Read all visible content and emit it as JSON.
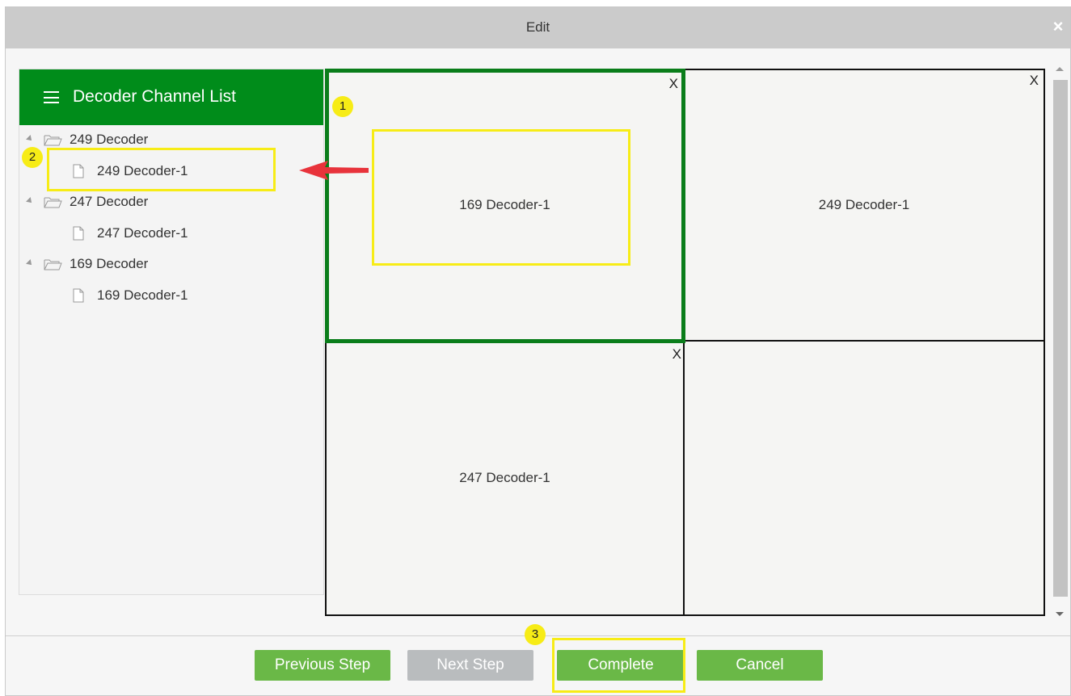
{
  "dialog": {
    "title": "Edit",
    "close_glyph": "×"
  },
  "channel_list": {
    "header_icon": "menu-icon",
    "title": "Decoder Channel List",
    "groups": [
      {
        "label": "249 Decoder",
        "items": [
          "249 Decoder-1"
        ]
      },
      {
        "label": "247 Decoder",
        "items": [
          "247 Decoder-1"
        ]
      },
      {
        "label": "169 Decoder",
        "items": [
          "169 Decoder-1"
        ]
      }
    ]
  },
  "screen_grid": {
    "cells": [
      {
        "label": "169 Decoder-1",
        "close": "X",
        "selected": true
      },
      {
        "label": "249 Decoder-1",
        "close": "X",
        "selected": false
      },
      {
        "label": "247 Decoder-1",
        "close": "X",
        "selected": false
      },
      {
        "label": "",
        "close": "",
        "selected": false
      }
    ]
  },
  "buttons": {
    "previous": "Previous Step",
    "next": "Next Step",
    "complete": "Complete",
    "cancel": "Cancel"
  },
  "annotations": {
    "step1": "1",
    "step2": "2",
    "step3": "3"
  },
  "colors": {
    "header_green": "#008c1a",
    "selected_border": "#0a7d1a",
    "button_green": "#6ab847",
    "button_disabled": "#b9bcbe",
    "highlight_yellow": "#f7ec16",
    "arrow_red": "#e8333b"
  }
}
